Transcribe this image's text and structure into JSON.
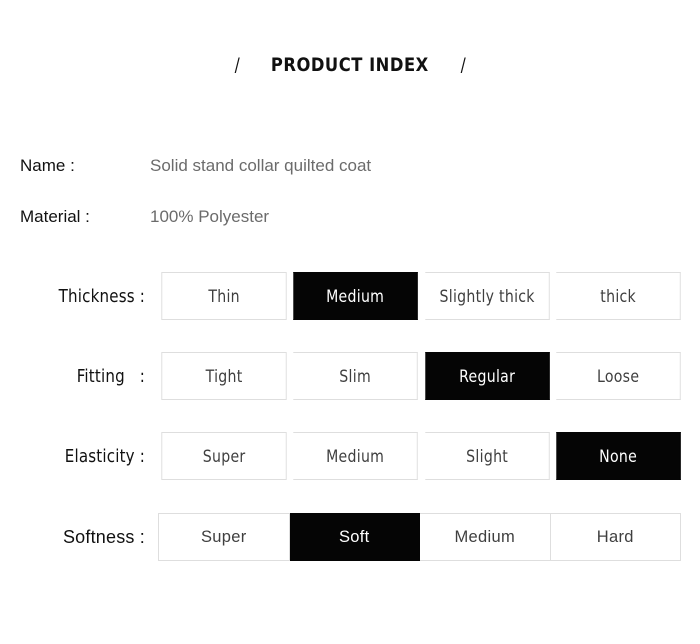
{
  "header": {
    "slash_left": "/",
    "title": "PRODUCT INDEX",
    "slash_right": "/"
  },
  "info": [
    {
      "label": "Name :",
      "value": "Solid stand collar quilted coat"
    },
    {
      "label": "Material :",
      "value": "100% Polyester"
    }
  ],
  "options": [
    {
      "label": "Thickness :",
      "choices": [
        "Thin",
        "Medium",
        "Slightly thick",
        "thick"
      ],
      "selected": "Medium",
      "selected_index": 1
    },
    {
      "label": "Fitting   :",
      "choices": [
        "Tight",
        "Slim",
        "Regular",
        "Loose"
      ],
      "selected": "Regular",
      "selected_index": 2
    },
    {
      "label": "Elasticity :",
      "choices": [
        "Super",
        "Medium",
        "Slight",
        "None"
      ],
      "selected": "None",
      "selected_index": 3
    },
    {
      "label": "Softness :",
      "choices": [
        "Super",
        "Soft",
        "Medium",
        "Hard"
      ],
      "selected": "Soft",
      "selected_index": 1
    }
  ],
  "colors": {
    "background": "#ffffff",
    "selected_fill": "#050505",
    "selected_text": "#ffffff",
    "cell_text": "#3f3f3f",
    "cell_border": "#dedede",
    "label_text": "#111111",
    "value_text": "#6b6b6b"
  }
}
